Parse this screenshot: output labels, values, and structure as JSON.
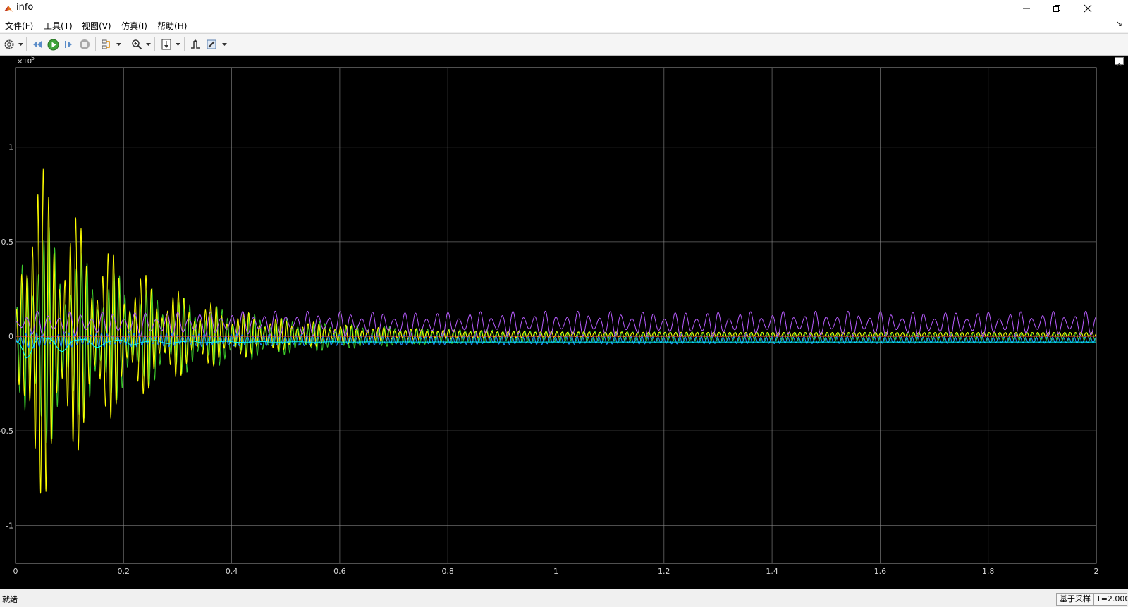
{
  "window": {
    "title": "info"
  },
  "menu": {
    "items": [
      {
        "label": "文件",
        "key": "(F)"
      },
      {
        "label": "工具",
        "key": "(T)"
      },
      {
        "label": "视图",
        "key": "(V)"
      },
      {
        "label": "仿真",
        "key": "(I)"
      },
      {
        "label": "帮助",
        "key": "(H)"
      }
    ],
    "dock_symbol": "↘"
  },
  "toolbar": {
    "icons": [
      "settings-icon",
      "step-back-icon",
      "run-icon",
      "step-forward-icon",
      "stop-icon",
      "highlight-icon",
      "zoom-icon",
      "autoscale-icon",
      "triggers-icon",
      "style-icon"
    ]
  },
  "chart_data": {
    "type": "line",
    "title": "",
    "xlabel": "",
    "ylabel": "",
    "exponent_label": "×10",
    "exponent_power": "5",
    "xlim": [
      0,
      2
    ],
    "ylim": [
      -1.2,
      1.42
    ],
    "x_ticks": [
      0,
      0.2,
      0.4,
      0.6,
      0.8,
      1,
      1.2,
      1.4,
      1.6,
      1.8,
      2
    ],
    "x_tick_labels": [
      "0",
      "0.2",
      "0.4",
      "0.6",
      "0.8",
      "1",
      "1.2",
      "1.4",
      "1.6",
      "1.8",
      "2"
    ],
    "y_ticks": [
      -1,
      -0.5,
      0,
      0.5,
      1
    ],
    "y_tick_labels": [
      "-1",
      "-0.5",
      "0",
      "0.5",
      "1"
    ],
    "grid": true,
    "background": "#000000",
    "grid_color": "#8c8c8c",
    "series": [
      {
        "color": "#3ccc2a",
        "envelope_peak": 0.74,
        "envelope_decay": 4.5,
        "osc_freq_hz": 100,
        "final_offset": 0.0,
        "final_amplitude": 0.02
      },
      {
        "color": "#ffff00",
        "envelope_peak": 1.15,
        "envelope_decay": 5.5,
        "osc_freq_hz": 100,
        "final_offset": 0.01,
        "final_amplitude": 0.01
      },
      {
        "color": "#b85cff",
        "envelope_peak": 0.06,
        "envelope_decay": 0.0,
        "osc_freq_hz": 50,
        "final_offset": 0.065,
        "final_amplitude": 0.008
      },
      {
        "color": "#1e90ff",
        "envelope_peak": 0.03,
        "envelope_decay": 1.0,
        "osc_freq_hz": 100,
        "final_offset": -0.02,
        "final_amplitude": 0.012
      },
      {
        "color": "#00ffff",
        "envelope_peak": 0.1,
        "envelope_decay": 8.0,
        "osc_freq_hz": 15,
        "final_offset": -0.03,
        "final_amplitude": 0.0
      },
      {
        "color": "#ff4040",
        "envelope_peak": 0.0,
        "envelope_decay": 0.0,
        "osc_freq_hz": 0,
        "final_offset": 0.0,
        "final_amplitude": 0.0
      }
    ]
  },
  "status": {
    "left": "就绪",
    "mode": "基于采样",
    "time": "T=2.000"
  }
}
